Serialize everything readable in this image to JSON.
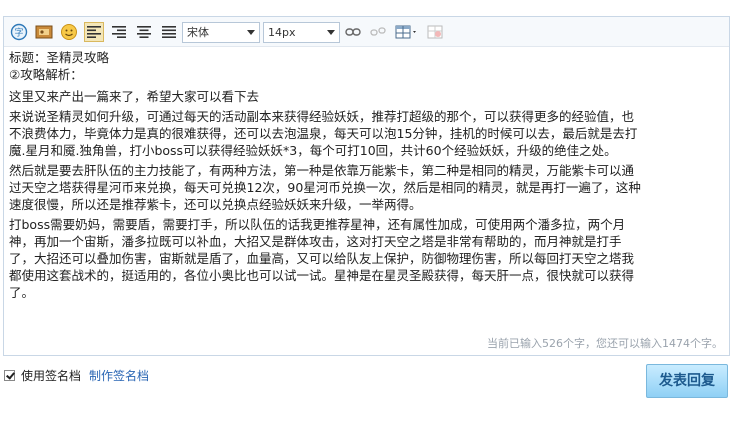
{
  "toolbar": {
    "font_family": "宋体",
    "font_size": "14px"
  },
  "content": {
    "lines": [
      "标题：圣精灵攻略",
      "②攻略解析：",
      "这里又来产出一篇来了，希望大家可以看下去",
      "来说说圣精灵如何升级，可通过每天的活动副本来获得经验妖妖，推荐打超级的那个，可以获得更多的经验值，也",
      "不浪费体力，毕竟体力是真的很难获得，还可以去泡温泉，每天可以泡15分钟，挂机的时候可以去，最后就是去打",
      "魔.星月和魇.独角兽，打小boss可以获得经验妖妖*3，每个可打10回，共计60个经验妖妖，升级的绝佳之处。",
      "然后就是要去肝队伍的主力技能了，有两种方法，第一种是依靠万能紫卡，第二种是相同的精灵，万能紫卡可以通",
      "过天空之塔获得星河币来兑换，每天可兑换12次，90星河币兑换一次，然后是相同的精灵，就是再打一遍了，这种",
      "速度很慢，所以还是推荐紫卡，还可以兑换点经验妖妖来升级，一举两得。",
      "打boss需要奶妈，需要盾，需要打手，所以队伍的话我更推荐星神，还有属性加成，可使用两个潘多拉，两个月",
      "神，再加一个宙斯，潘多拉既可以补血，大招又是群体攻击，这对打天空之塔是非常有帮助的，而月神就是打手",
      "了，大招还可以叠加伤害，宙斯就是盾了，血量高，又可以给队友上保护，防御物理伤害，所以每回打天空之塔我",
      "都使用这套战术的，挺适用的，各位小奥比也可以试一试。星神是在星灵圣殿获得，每天肝一点，很快就可以获得",
      "了。"
    ]
  },
  "status_text": "当前已输入526个字，您还可以输入1474个字。",
  "signature": {
    "checkbox_label": "使用签名档",
    "link_label": "制作签名档"
  },
  "submit_label": "发表回复"
}
